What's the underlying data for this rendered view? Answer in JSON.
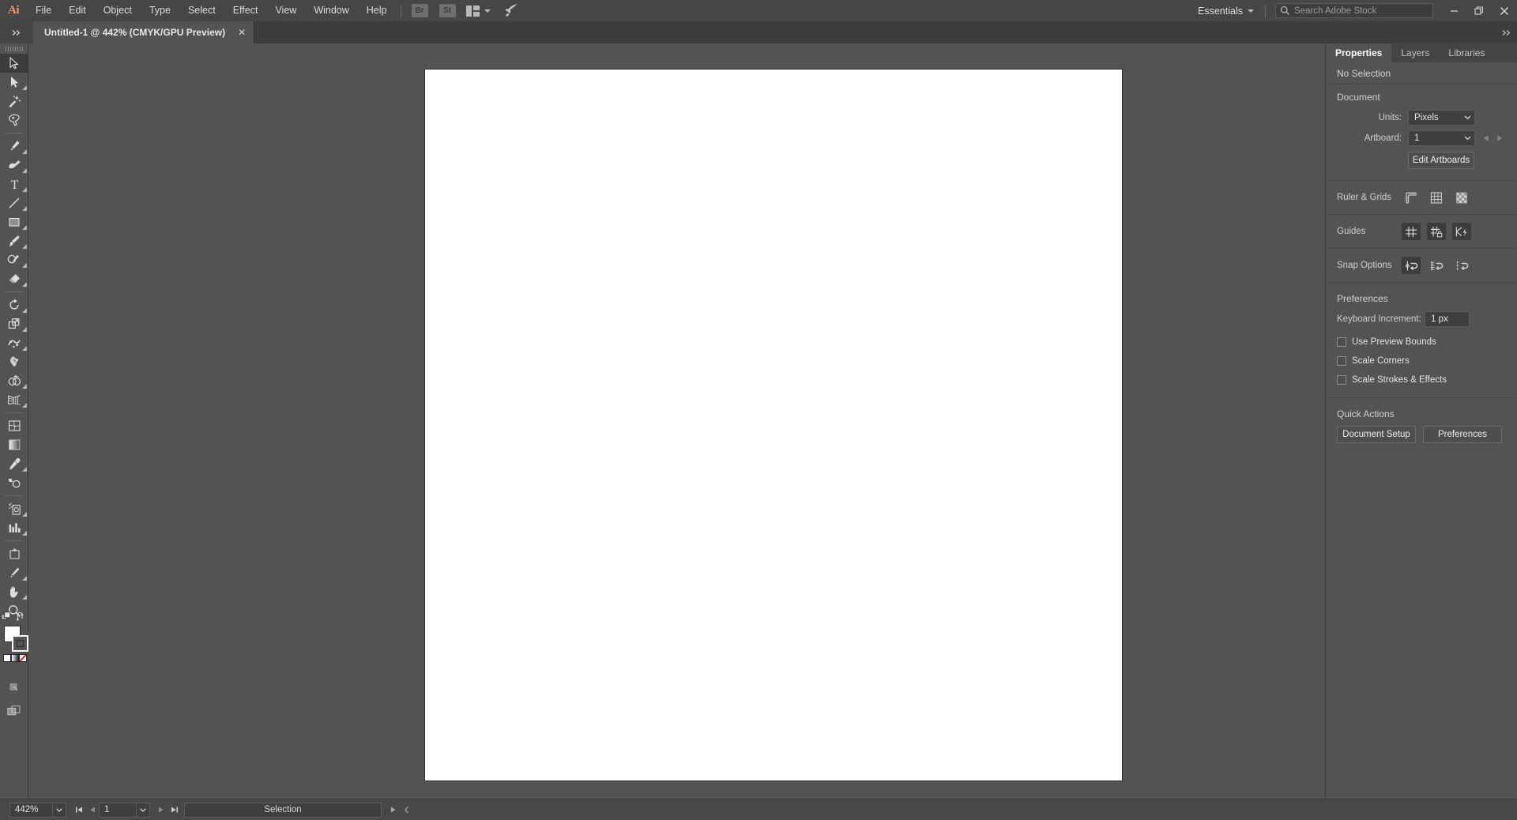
{
  "app": {
    "name": "Adobe Illustrator",
    "logo": "Ai"
  },
  "menubar": {
    "items": [
      {
        "label": "File"
      },
      {
        "label": "Edit"
      },
      {
        "label": "Object"
      },
      {
        "label": "Type"
      },
      {
        "label": "Select"
      },
      {
        "label": "Effect"
      },
      {
        "label": "View"
      },
      {
        "label": "Window"
      },
      {
        "label": "Help"
      }
    ],
    "app_buttons": [
      {
        "name": "bridge-button",
        "label": "Br"
      },
      {
        "name": "stock-button",
        "label": "St"
      }
    ],
    "arrange_documents_label": "Arrange Documents",
    "rocket_label": "Discover",
    "workspace": {
      "label": "Essentials"
    },
    "search": {
      "placeholder": "Search Adobe Stock",
      "value": ""
    },
    "window_controls": {
      "minimize": "—",
      "restore": "❐",
      "close": "✕"
    }
  },
  "tabbar": {
    "document": {
      "title": "Untitled-1 @ 442% (CMYK/GPU Preview)",
      "close": "✕"
    },
    "left_collapse": "»",
    "right_collapse": "»"
  },
  "toolbar": {
    "tools": [
      {
        "name": "selection-tool",
        "label": "Selection",
        "selected": true,
        "flyout": false
      },
      {
        "name": "direct-selection-tool",
        "label": "Direct Selection",
        "selected": false,
        "flyout": true
      },
      {
        "name": "magic-wand-tool",
        "label": "Magic Wand",
        "selected": false,
        "flyout": false
      },
      {
        "name": "lasso-tool",
        "label": "Lasso",
        "selected": false,
        "flyout": false
      },
      {
        "divider": true
      },
      {
        "name": "pen-tool",
        "label": "Pen",
        "selected": false,
        "flyout": true
      },
      {
        "name": "curvature-tool",
        "label": "Curvature",
        "selected": false,
        "flyout": false
      },
      {
        "name": "type-tool",
        "label": "Type",
        "selected": false,
        "flyout": true
      },
      {
        "name": "line-segment-tool",
        "label": "Line Segment",
        "selected": false,
        "flyout": true
      },
      {
        "name": "rectangle-tool",
        "label": "Rectangle",
        "selected": false,
        "flyout": true
      },
      {
        "name": "paintbrush-tool",
        "label": "Paintbrush",
        "selected": false,
        "flyout": true
      },
      {
        "name": "shaper-tool",
        "label": "Shaper / Pencil",
        "selected": false,
        "flyout": true
      },
      {
        "name": "eraser-tool",
        "label": "Eraser",
        "selected": false,
        "flyout": true
      },
      {
        "divider": true
      },
      {
        "name": "rotate-tool",
        "label": "Rotate",
        "selected": false,
        "flyout": true
      },
      {
        "name": "scale-tool",
        "label": "Scale",
        "selected": false,
        "flyout": true
      },
      {
        "name": "width-tool",
        "label": "Width / Warp",
        "selected": false,
        "flyout": true
      },
      {
        "name": "free-transform-tool",
        "label": "Free Transform",
        "selected": false,
        "flyout": false
      },
      {
        "name": "shape-builder-tool",
        "label": "Shape Builder",
        "selected": false,
        "flyout": true
      },
      {
        "name": "perspective-grid-tool",
        "label": "Perspective Grid",
        "selected": false,
        "flyout": true
      },
      {
        "divider": true
      },
      {
        "name": "mesh-tool",
        "label": "Mesh",
        "selected": false,
        "flyout": false
      },
      {
        "name": "gradient-tool",
        "label": "Gradient",
        "selected": false,
        "flyout": false
      },
      {
        "name": "eyedropper-tool",
        "label": "Eyedropper",
        "selected": false,
        "flyout": true
      },
      {
        "name": "blend-tool",
        "label": "Blend",
        "selected": false,
        "flyout": false
      },
      {
        "divider": true
      },
      {
        "name": "symbol-sprayer-tool",
        "label": "Symbol Sprayer",
        "selected": false,
        "flyout": true
      },
      {
        "name": "column-graph-tool",
        "label": "Column Graph",
        "selected": false,
        "flyout": true
      },
      {
        "divider": true
      },
      {
        "name": "artboard-tool",
        "label": "Artboard",
        "selected": false,
        "flyout": false
      },
      {
        "name": "slice-tool",
        "label": "Slice",
        "selected": false,
        "flyout": true
      },
      {
        "name": "hand-tool",
        "label": "Hand",
        "selected": false,
        "flyout": true
      },
      {
        "name": "zoom-tool",
        "label": "Zoom",
        "selected": false,
        "flyout": false
      }
    ],
    "color_controls": {
      "default_colors_label": "Default Fill and Stroke",
      "swap_label": "Swap Fill and Stroke",
      "fill_color": "#ffffff",
      "stroke_color": "#000000",
      "color_mode_label": "Color",
      "gradient_label": "Gradient",
      "none_label": "None",
      "drawing_mode_label": "Draw Normal",
      "screen_mode_label": "Change Screen Mode"
    },
    "grip_label": "Toolbar drag handle"
  },
  "canvas": {
    "artboard_label": "Artboard 1",
    "background_color": "#535353",
    "artboard_color": "#ffffff"
  },
  "statusbar": {
    "zoom": {
      "value": "442%"
    },
    "artboard_nav": {
      "first": "⏮",
      "prev": "◀",
      "value": "1",
      "next": "▶",
      "last": "⏭"
    },
    "status_text": "Selection",
    "expand": "▶",
    "collapse": "‹"
  },
  "properties_panel": {
    "tabs": [
      {
        "label": "Properties",
        "active": true
      },
      {
        "label": "Layers",
        "active": false
      },
      {
        "label": "Libraries",
        "active": false
      }
    ],
    "selection_state": "No Selection",
    "document": {
      "title": "Document",
      "units": {
        "label": "Units:",
        "value": "Pixels"
      },
      "artboard": {
        "label": "Artboard:",
        "value": "1"
      },
      "edit_artboards_label": "Edit Artboards"
    },
    "ruler_grids": {
      "title": "Ruler & Grids",
      "buttons": [
        {
          "name": "show-rulers-button",
          "label": "Show Rulers",
          "active": false
        },
        {
          "name": "show-grid-button",
          "label": "Show Grid",
          "active": false
        },
        {
          "name": "show-transparency-grid-button",
          "label": "Show Transparency Grid",
          "active": false
        }
      ]
    },
    "guides": {
      "title": "Guides",
      "buttons": [
        {
          "name": "show-guides-button",
          "label": "Show Guides",
          "active": true
        },
        {
          "name": "lock-guides-button",
          "label": "Lock Guides",
          "active": true
        },
        {
          "name": "smart-guides-button",
          "label": "Smart Guides",
          "active": true
        }
      ]
    },
    "snap_options": {
      "title": "Snap Options",
      "buttons": [
        {
          "name": "snap-to-point-button",
          "label": "Snap to Point",
          "active": true
        },
        {
          "name": "snap-to-grid-button",
          "label": "Snap to Grid",
          "active": false
        },
        {
          "name": "snap-to-pixel-button",
          "label": "Snap to Pixel",
          "active": false
        }
      ]
    },
    "preferences": {
      "title": "Preferences",
      "keyboard_increment": {
        "label": "Keyboard Increment:",
        "value": "1 px"
      },
      "checkboxes": [
        {
          "name": "use-preview-bounds-checkbox",
          "label": "Use Preview Bounds",
          "checked": false
        },
        {
          "name": "scale-corners-checkbox",
          "label": "Scale Corners",
          "checked": false
        },
        {
          "name": "scale-strokes-effects-checkbox",
          "label": "Scale Strokes & Effects",
          "checked": false
        }
      ]
    },
    "quick_actions": {
      "title": "Quick Actions",
      "buttons": [
        {
          "name": "document-setup-button",
          "label": "Document Setup"
        },
        {
          "name": "preferences-button",
          "label": "Preferences"
        }
      ]
    }
  },
  "colors": {
    "menubar_bg": "#464646",
    "panel_bg": "#535353",
    "tabbar_bg": "#3d3d3d",
    "field_bg": "#3f3f3f",
    "accent_logo": "#f09a63",
    "text": "#d6d6d6"
  }
}
